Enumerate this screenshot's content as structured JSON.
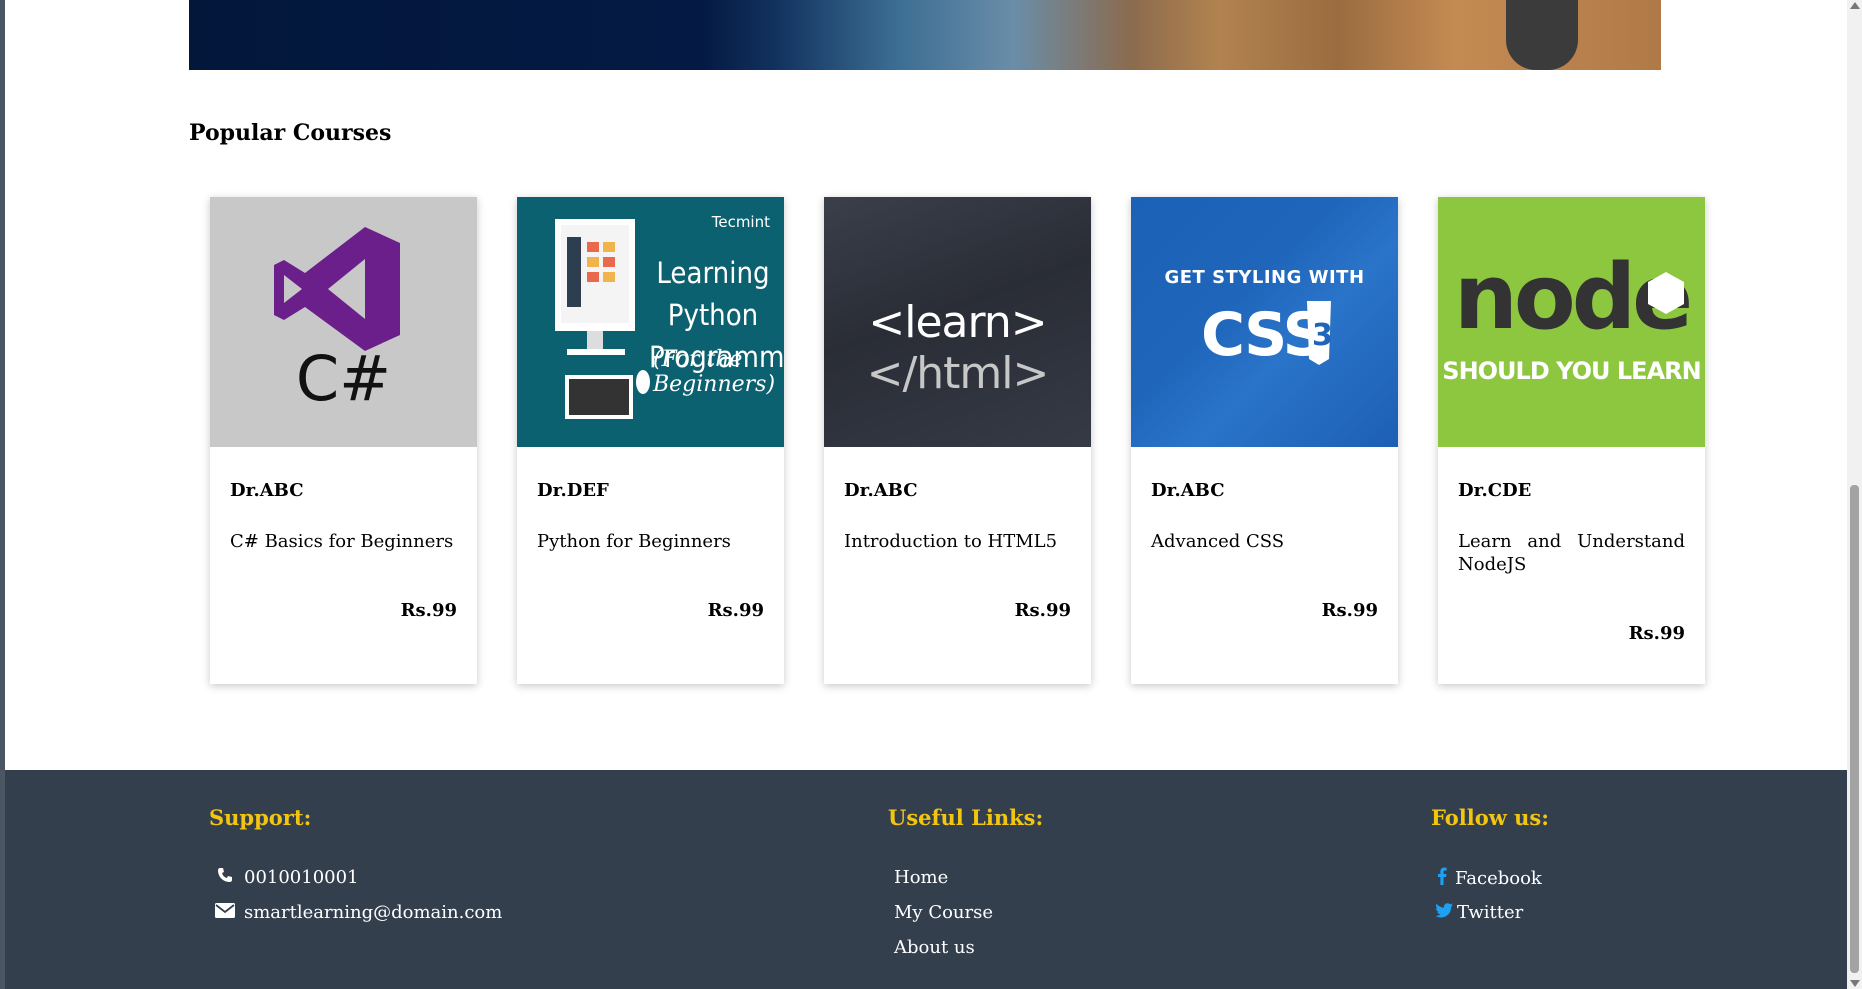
{
  "section": {
    "title": "Popular Courses"
  },
  "courses": [
    {
      "instructor": "Dr.ABC",
      "title": "C# Basics for Beginners",
      "price": "Rs.99",
      "thumb_text": "C#"
    },
    {
      "instructor": "Dr.DEF",
      "title": "Python for Beginners",
      "price": "Rs.99",
      "thumb_text": "Learning Python Programming",
      "thumb_sub": "(For the Beginners)",
      "thumb_brand": "Tecmint"
    },
    {
      "instructor": "Dr.ABC",
      "title": "Introduction to HTML5",
      "price": "Rs.99",
      "thumb_text_a": "<learn>",
      "thumb_text_b": "</html>"
    },
    {
      "instructor": "Dr.ABC",
      "title": "Advanced CSS",
      "price": "Rs.99",
      "thumb_top": "GET STYLING WITH",
      "thumb_text": "CSS"
    },
    {
      "instructor": "Dr.CDE",
      "title": "Learn and Understand NodeJS",
      "price": "Rs.99",
      "thumb_text": "node",
      "thumb_sub": "SHOULD YOU LEARN"
    }
  ],
  "footer": {
    "support": {
      "heading": "Support:",
      "phone": "0010010001",
      "email": "smartlearning@domain.com"
    },
    "links": {
      "heading": "Useful Links:",
      "items": [
        "Home",
        "My Course",
        "About us"
      ]
    },
    "follow": {
      "heading": "Follow us:",
      "items": [
        "Facebook",
        "Twitter"
      ]
    }
  },
  "colors": {
    "footer_bg": "#343f4e",
    "heading_accent": "#f2c511",
    "social_icon": "#1da1f2"
  },
  "icons": {
    "phone": "phone-icon",
    "email": "envelope-icon",
    "facebook": "facebook-icon",
    "twitter": "twitter-icon"
  }
}
